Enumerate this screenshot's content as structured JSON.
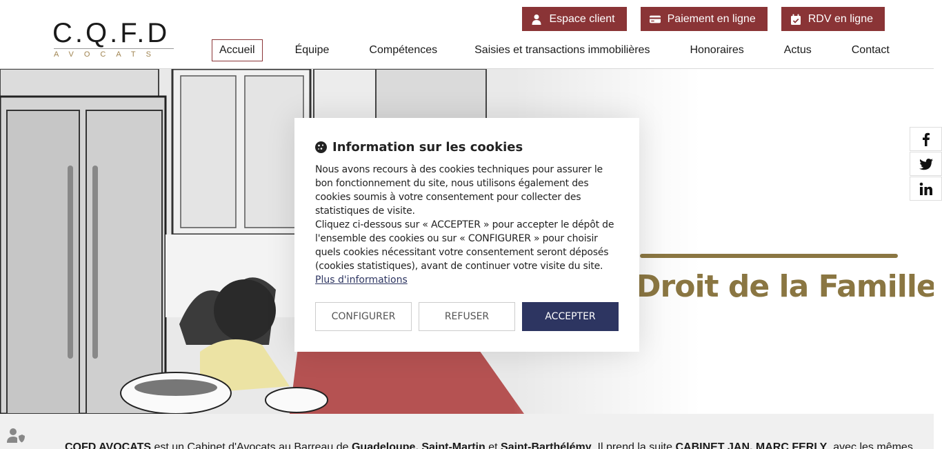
{
  "logo": {
    "top_text": "C.Q.F.D",
    "sub_text": "AVOCATS"
  },
  "top_buttons": [
    {
      "label": "Espace client",
      "icon": "user-icon"
    },
    {
      "label": "Paiement en ligne",
      "icon": "credit-card-icon"
    },
    {
      "label": "RDV en ligne",
      "icon": "calendar-check-icon"
    }
  ],
  "nav": {
    "items": [
      {
        "label": "Accueil",
        "active": true
      },
      {
        "label": "Équipe"
      },
      {
        "label": "Compétences"
      },
      {
        "label": "Saisies et transactions immobilières"
      },
      {
        "label": "Honoraires"
      },
      {
        "label": "Actus"
      },
      {
        "label": "Contact"
      }
    ]
  },
  "hero": {
    "title": "Droit de la Famille"
  },
  "social": [
    "facebook-icon",
    "twitter-icon",
    "linkedin-icon"
  ],
  "cookie_modal": {
    "title": "Information sur les cookies",
    "paragraph1": "Nous avons recours à des cookies techniques pour assurer le bon fonctionnement du site, nous utilisons également des cookies soumis à votre consentement pour collecter des statistiques de visite.",
    "paragraph2": "Cliquez ci-dessous sur « ACCEPTER » pour accepter le dépôt de l'ensemble des cookies ou sur « CONFIGURER » pour choisir quels cookies nécessitant votre consentement seront déposés (cookies statistiques), avant de continuer votre visite du site.",
    "more_link": "Plus d'informations",
    "btn_configure": "CONFIGURER",
    "btn_refuse": "REFUSER",
    "btn_accept": "ACCEPTER"
  },
  "band": {
    "part1": "CQFD AVOCATS",
    "part2": " est un Cabinet d'Avocats au Barreau de ",
    "part3": "Guadeloupe, Saint-Martin",
    "part4": " et ",
    "part5": "Saint-Barthélémy",
    "part6": ". Il prend la suite ",
    "part7": "CABINET JAN, MARC FERLY",
    "part8": ", avec les mêmes"
  },
  "colors": {
    "brand_red": "#8a3436",
    "gold": "#8a7642",
    "navy": "#2d3561"
  }
}
